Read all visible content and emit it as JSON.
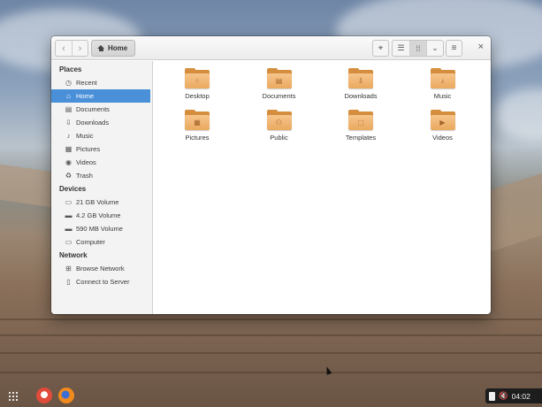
{
  "window": {
    "path_label": "Home",
    "nav_back_icon": "chevron-left-icon",
    "nav_forward_icon": "chevron-right-icon",
    "close_glyph": "×"
  },
  "sidebar": {
    "sections": [
      {
        "title": "Places",
        "items": [
          {
            "label": "Recent",
            "icon": "clock-icon",
            "glyph": "◷",
            "active": false
          },
          {
            "label": "Home",
            "icon": "home-icon",
            "glyph": "⌂",
            "active": true
          },
          {
            "label": "Documents",
            "icon": "document-icon",
            "glyph": "▤",
            "active": false
          },
          {
            "label": "Downloads",
            "icon": "download-icon",
            "glyph": "⇩",
            "active": false
          },
          {
            "label": "Music",
            "icon": "music-icon",
            "glyph": "♪",
            "active": false
          },
          {
            "label": "Pictures",
            "icon": "picture-icon",
            "glyph": "▦",
            "active": false
          },
          {
            "label": "Videos",
            "icon": "video-icon",
            "glyph": "◉",
            "active": false
          },
          {
            "label": "Trash",
            "icon": "trash-icon",
            "glyph": "♻",
            "active": false
          }
        ]
      },
      {
        "title": "Devices",
        "items": [
          {
            "label": "21 GB Volume",
            "icon": "drive-icon",
            "glyph": "▭",
            "active": false
          },
          {
            "label": "4.2 GB Volume",
            "icon": "drive-icon",
            "glyph": "▬",
            "active": false
          },
          {
            "label": "590 MB Volume",
            "icon": "drive-icon",
            "glyph": "▬",
            "active": false
          },
          {
            "label": "Computer",
            "icon": "computer-icon",
            "glyph": "▭",
            "active": false
          }
        ]
      },
      {
        "title": "Network",
        "items": [
          {
            "label": "Browse Network",
            "icon": "network-icon",
            "glyph": "⊞",
            "active": false
          },
          {
            "label": "Connect to Server",
            "icon": "server-icon",
            "glyph": "▯",
            "active": false
          }
        ]
      }
    ]
  },
  "files": [
    {
      "label": "Desktop",
      "icon": "desktop-folder-icon",
      "glyph": "⁘"
    },
    {
      "label": "Documents",
      "icon": "documents-folder-icon",
      "glyph": "▤"
    },
    {
      "label": "Downloads",
      "icon": "downloads-folder-icon",
      "glyph": "⇩"
    },
    {
      "label": "Music",
      "icon": "music-folder-icon",
      "glyph": "♪"
    },
    {
      "label": "Pictures",
      "icon": "pictures-folder-icon",
      "glyph": "▦"
    },
    {
      "label": "Public",
      "icon": "public-folder-icon",
      "glyph": "⚇"
    },
    {
      "label": "Templates",
      "icon": "templates-folder-icon",
      "glyph": "⬚"
    },
    {
      "label": "Videos",
      "icon": "videos-folder-icon",
      "glyph": "▶"
    }
  ],
  "panel": {
    "clock": "04:02"
  },
  "colors": {
    "accent": "#4a90d9",
    "folder": "#eaa95f"
  }
}
